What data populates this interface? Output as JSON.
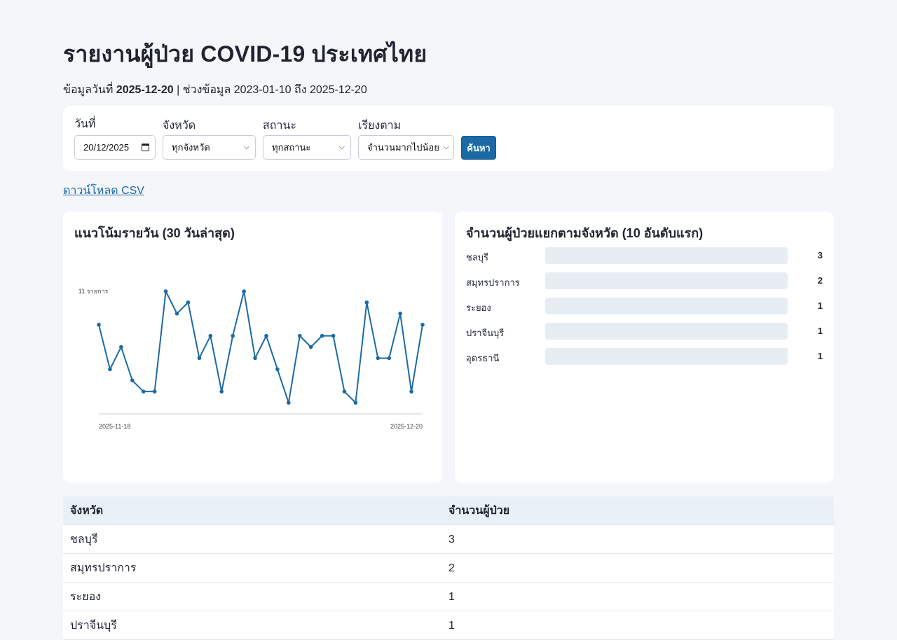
{
  "header": {
    "title": "รายงานผู้ป่วย COVID-19 ประเทศไทย",
    "subtitle_prefix": "ข้อมูลวันที่",
    "data_date": "2025-12-20",
    "subtitle_range": "| ช่วงข้อมูล 2023-01-10 ถึง 2025-12-20"
  },
  "filters": {
    "date_label": "วันที่",
    "date_value": "20/12/2025",
    "province_label": "จังหวัด",
    "province_value": "ทุกจังหวัด",
    "status_label": "สถานะ",
    "status_value": "ทุกสถานะ",
    "sort_label": "เรียงตาม",
    "sort_value": "จำนวนมากไปน้อย",
    "search_label": "ค้นหา"
  },
  "download_label": "ดาวน์โหลด CSV",
  "colors": {
    "accent": "#1b6aa5",
    "bar_track": "#e8edf4",
    "table_header": "#e9f0f7"
  },
  "chart_data": [
    {
      "type": "line",
      "title": "แนวโน้มรายวัน (30 วันล่าสุด)",
      "x_start_label": "2025-11-18",
      "x_end_label": "2025-12-20",
      "max_label": "11 รายการ",
      "ylim": [
        0,
        11
      ],
      "values": [
        8,
        4,
        6,
        3,
        2,
        2,
        11,
        9,
        10,
        5,
        7,
        2,
        7,
        11,
        5,
        7,
        4,
        1,
        7,
        6,
        7,
        7,
        2,
        1,
        10,
        5,
        5,
        9,
        2,
        8
      ]
    },
    {
      "type": "bar",
      "title": "จำนวนผู้ป่วยแยกตามจังหวัด (10 อันดับแรก)",
      "categories": [
        "ชลบุรี",
        "สมุทรปราการ",
        "ระยอง",
        "ปราจีนบุรี",
        "อุดรธานี"
      ],
      "values": [
        3,
        2,
        1,
        1,
        1
      ]
    }
  ],
  "table": {
    "headers": [
      "จังหวัด",
      "จำนวนผู้ป่วย"
    ],
    "rows": [
      [
        "ชลบุรี",
        "3"
      ],
      [
        "สมุทรปราการ",
        "2"
      ],
      [
        "ระยอง",
        "1"
      ],
      [
        "ปราจีนบุรี",
        "1"
      ]
    ]
  }
}
